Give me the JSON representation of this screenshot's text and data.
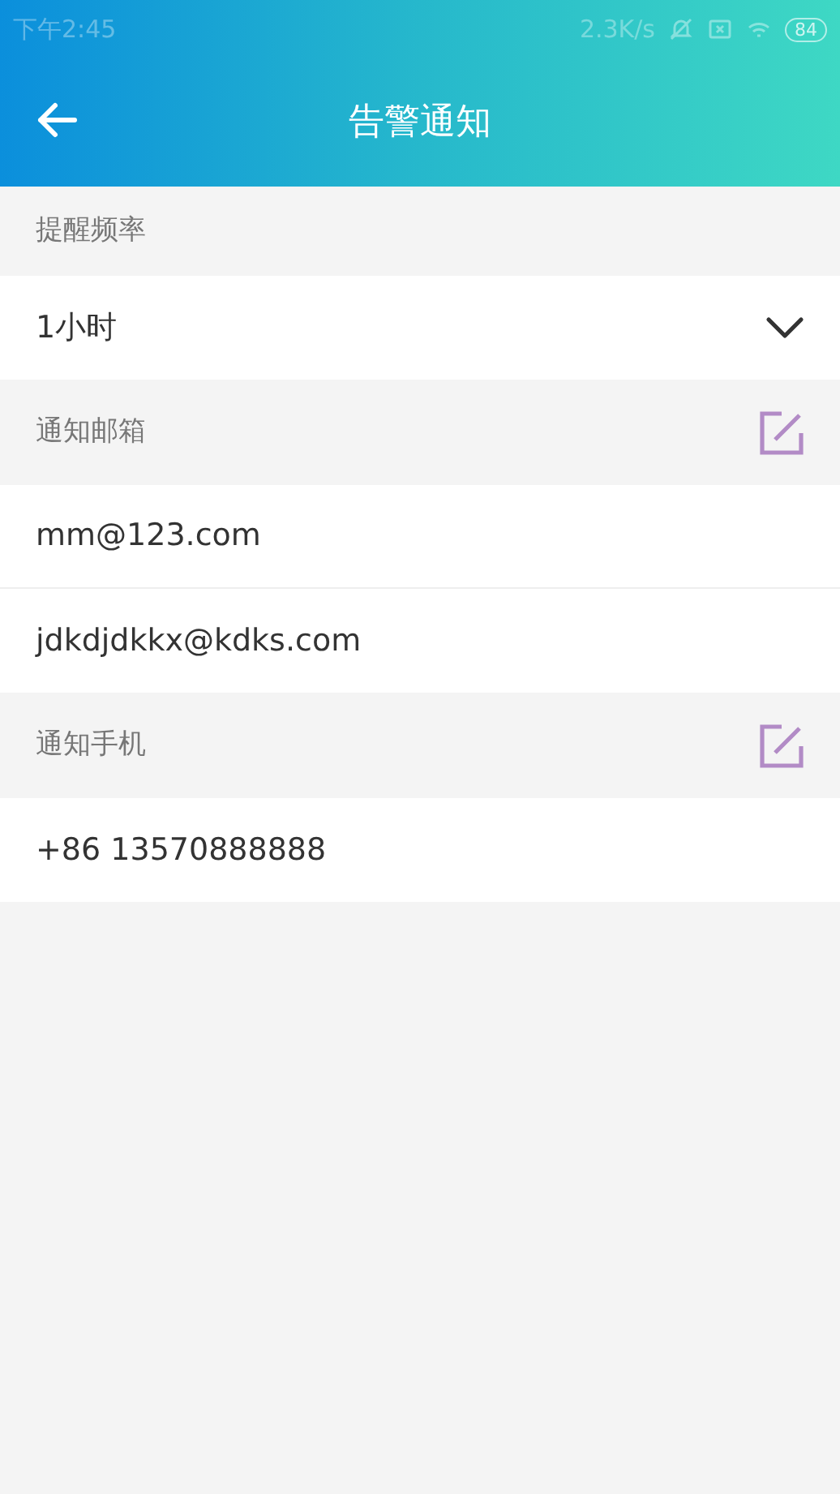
{
  "status_bar": {
    "time": "下午2:45",
    "speed": "2.3K/s",
    "battery": "84"
  },
  "header": {
    "title": "告警通知"
  },
  "sections": [
    {
      "kind": "select",
      "label": "提醒频率",
      "items": [
        "1小时"
      ]
    },
    {
      "kind": "editable",
      "label": "通知邮箱",
      "items": [
        "mm@123.com",
        "jdkdjdkkx@kdks.com"
      ]
    },
    {
      "kind": "editable",
      "label": "通知手机",
      "items": [
        "+86 13570888888"
      ]
    }
  ]
}
